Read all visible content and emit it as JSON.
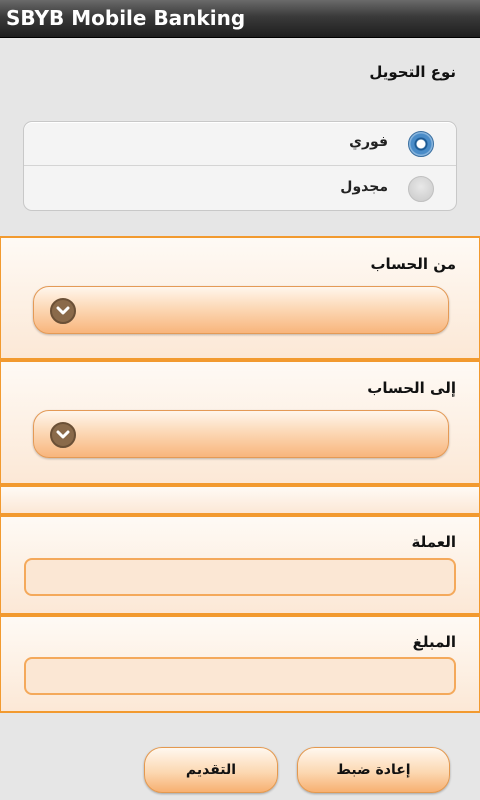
{
  "app": {
    "title": "SBYB Mobile Banking"
  },
  "transfer_type": {
    "label": "نوع التحويل",
    "options": [
      {
        "label": "فوري",
        "selected": true
      },
      {
        "label": "مجدول",
        "selected": false
      }
    ]
  },
  "from_account": {
    "label": "من الحساب",
    "value": ""
  },
  "to_account": {
    "label": "إلى الحساب",
    "value": ""
  },
  "currency": {
    "label": "العملة",
    "value": ""
  },
  "amount": {
    "label": "المبلغ",
    "value": ""
  },
  "buttons": {
    "reset": "إعادة ضبط",
    "submit": "التقديم"
  },
  "colors": {
    "accent": "#f29a2f",
    "radio_selected": "#3f83c4",
    "titlebar": "#2a2a2a"
  }
}
